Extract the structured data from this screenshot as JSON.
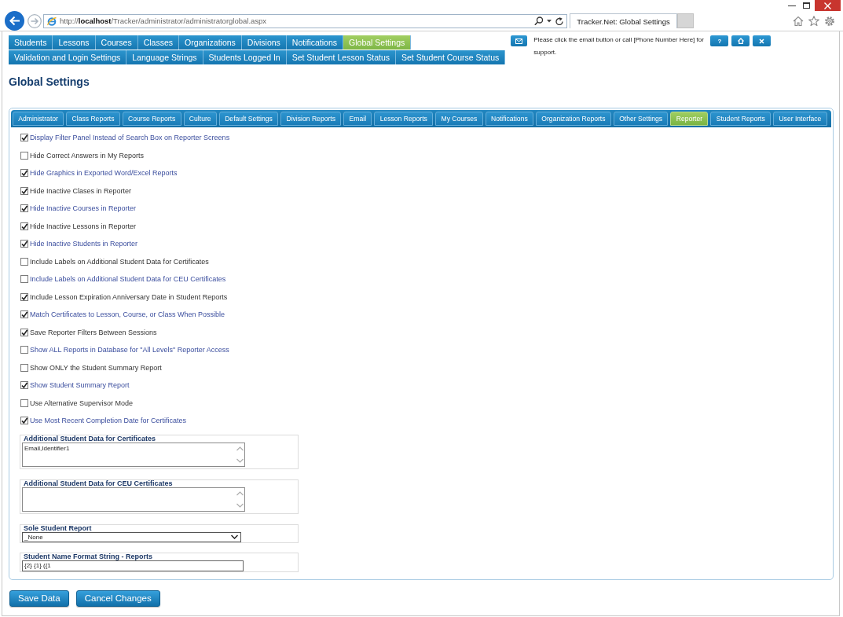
{
  "browser": {
    "address": "http://**localhost**/Tracker/administrator/administratorglobal.aspx",
    "tab_title": "Tracker.Net: Global Settings"
  },
  "main_menu": [
    {
      "label": "Students",
      "selected": false
    },
    {
      "label": "Lessons",
      "selected": false
    },
    {
      "label": "Courses",
      "selected": false
    },
    {
      "label": "Classes",
      "selected": false
    },
    {
      "label": "Organizations",
      "selected": false
    },
    {
      "label": "Divisions",
      "selected": false
    },
    {
      "label": "Notifications",
      "selected": false
    },
    {
      "label": "Global Settings",
      "selected": true
    }
  ],
  "sub_menu": [
    {
      "label": "Validation and Login Settings",
      "selected": false
    },
    {
      "label": "Language Strings",
      "selected": false
    },
    {
      "label": "Students Logged In",
      "selected": false
    },
    {
      "label": "Set Student Lesson Status",
      "selected": false
    },
    {
      "label": "Set Student Course Status",
      "selected": false
    }
  ],
  "support": {
    "message": "Please click the email button or call [Phone Number Here] for support.",
    "help_button": "?"
  },
  "page_title": "Global Settings",
  "settings_tabs": [
    {
      "label": "Administrator",
      "selected": false
    },
    {
      "label": "Class Reports",
      "selected": false
    },
    {
      "label": "Course Reports",
      "selected": false
    },
    {
      "label": "Culture",
      "selected": false
    },
    {
      "label": "Default Settings",
      "selected": false
    },
    {
      "label": "Division Reports",
      "selected": false
    },
    {
      "label": "Email",
      "selected": false
    },
    {
      "label": "Lesson Reports",
      "selected": false
    },
    {
      "label": "My Courses",
      "selected": false
    },
    {
      "label": "Notifications",
      "selected": false
    },
    {
      "label": "Organization Reports",
      "selected": false
    },
    {
      "label": "Other Settings",
      "selected": false
    },
    {
      "label": "Reporter",
      "selected": true
    },
    {
      "label": "Student Reports",
      "selected": false
    },
    {
      "label": "User Interface",
      "selected": false
    }
  ],
  "options": [
    {
      "label": "Display Filter Panel Instead of Search Box on Reporter Screens",
      "checked": true
    },
    {
      "label": "Hide Correct Answers in My Reports",
      "checked": false
    },
    {
      "label": "Hide Graphics in Exported Word/Excel Reports",
      "checked": true
    },
    {
      "label": "Hide Inactive Clases in Reporter",
      "checked": true
    },
    {
      "label": "Hide Inactive Courses in Reporter",
      "checked": true
    },
    {
      "label": "Hide Inactive Lessons in Reporter",
      "checked": true
    },
    {
      "label": "Hide Inactive Students in Reporter",
      "checked": true
    },
    {
      "label": "Include Labels on Additional Student Data for Certificates",
      "checked": false
    },
    {
      "label": "Include Labels on Additional Student Data for CEU Certificates",
      "checked": false
    },
    {
      "label": "Include Lesson Expiration Anniversary Date in Student Reports",
      "checked": true
    },
    {
      "label": "Match Certificates to Lesson, Course, or Class When Possible",
      "checked": true
    },
    {
      "label": "Save Reporter Filters Between Sessions",
      "checked": true
    },
    {
      "label": "Show ALL Reports in Database for \"All Levels\" Reporter Access",
      "checked": false
    },
    {
      "label": "Show ONLY the Student Summary Report",
      "checked": false
    },
    {
      "label": "Show Student Summary Report",
      "checked": true
    },
    {
      "label": "Use Alternative Supervisor Mode",
      "checked": false
    },
    {
      "label": "Use Most Recent Completion Date for Certificates",
      "checked": true
    }
  ],
  "fields": [
    {
      "kind": "textarea",
      "label": "Additional Student Data for Certificates",
      "value": "Email,Identifier1"
    },
    {
      "kind": "textarea",
      "label": "Additional Student Data for CEU Certificates"
    },
    {
      "kind": "select",
      "label": "Sole Student Report",
      "value": "_None"
    },
    {
      "kind": "text",
      "label": "Student Name Format String - Reports",
      "value": "{2} {1} ({1"
    }
  ],
  "buttons": [
    "Save Data",
    "Cancel Changes"
  ]
}
